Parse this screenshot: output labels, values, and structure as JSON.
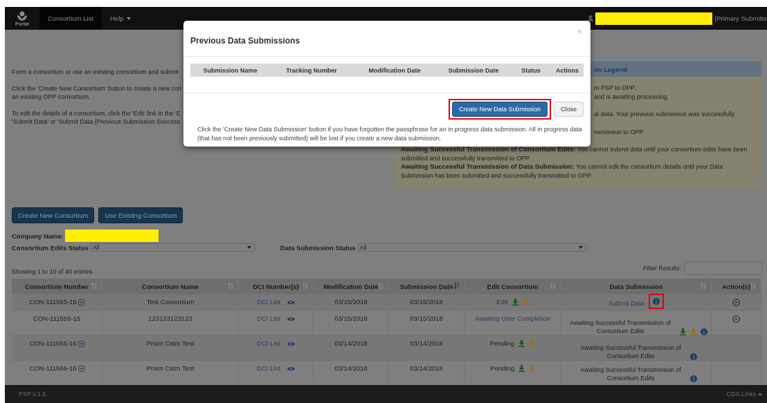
{
  "navbar": {
    "logo_text": "Portal",
    "items": [
      {
        "label": "Consortium List",
        "selected": true,
        "dropdown": false
      },
      {
        "label": "Help",
        "selected": false,
        "dropdown": true
      }
    ],
    "user_role": "(Primary Submitte"
  },
  "intro": {
    "paragraphs": [
      [
        "Form a consortium or use an existing consortium and submit"
      ],
      [
        "Click the 'Create New Consortium' button to create a new con",
        "an existing OPP consortium."
      ],
      [
        "To edit the details of a consortium, click the 'Edit' link in the 'E",
        "'Submit Data' or 'Submit Data (Previous Submission Success"
      ]
    ]
  },
  "legend": {
    "title": "on Legend",
    "paragraphs": [
      [
        "m PSP to OPP.",
        "and is awaiting processing."
      ],
      [
        "al data. Your previous submission was successfully"
      ],
      [
        "nsmission to OPP"
      ]
    ],
    "entries": [
      "**Awaiting Successful Transmission of Consortium Edits:** You cannot submit data until your consortium edits have been submitted and successfully transmitted to OPP.",
      "**Awaiting Successful Transmission of Data Submission:** You cannot edit the consortium details until your Data Submission has been submitted and successfully transmitted to OPP."
    ]
  },
  "buttons": [
    "Create New Consortium",
    "Use Existing Consortium"
  ],
  "company_name": {
    "label": "Company Name:"
  },
  "filters": [
    {
      "label": "Consortium Edits Status",
      "value": "All"
    },
    {
      "label": "Data Submission Status",
      "value": "All"
    }
  ],
  "entries_info": "Showing 1 to 10 of 40 entries",
  "filter_results": {
    "label": "Filter Results:"
  },
  "table": {
    "columns": [
      {
        "label": "Consortium Number",
        "sorted": false
      },
      {
        "label": "Consortium Name",
        "sorted": false
      },
      {
        "label": "DCI Number(s)",
        "sorted": false
      },
      {
        "label": "Modification Date",
        "sorted": false
      },
      {
        "label": "Submission Date",
        "sorted": true
      },
      {
        "label": "Edit Consortium",
        "sorted": false
      },
      {
        "label": "Data Submission",
        "sorted": false
      },
      {
        "label": "Action(s)",
        "sorted": false
      }
    ],
    "rows": [
      {
        "number": "CON-111555-15",
        "menu": true,
        "name": "Test Consortium",
        "dci": "DCI List",
        "modified": "03/15/2018",
        "submitted": "03/15/2018",
        "edit": {
          "text": "Edit",
          "kind": "link",
          "downloads": true
        },
        "data": {
          "text": "Submit Data",
          "kind": "link",
          "downloads": false,
          "highlighted": true
        },
        "action": true
      },
      {
        "number": "CON-111555-15",
        "menu": false,
        "name": "123123123123",
        "dci": "DCI List",
        "modified": "03/15/2018",
        "submitted": "03/15/2018",
        "edit": {
          "text": "Awaiting User Completion",
          "kind": "link",
          "downloads": false
        },
        "data": {
          "text": "Awaiting Successful Transmission of Consortium Edits",
          "kind": "plain",
          "downloads": true,
          "highlighted": false
        },
        "action": true
      },
      {
        "number": "CON-111666-16",
        "menu": true,
        "name": "Prism Cstm Test",
        "dci": "DCI List",
        "modified": "03/14/2018",
        "submitted": "03/14/2018",
        "edit": {
          "text": "Pending",
          "kind": "plain",
          "downloads": true
        },
        "data": {
          "text": "Awaiting Successful Transmission of Consortium Edits",
          "kind": "plain",
          "downloads": false,
          "highlighted": false
        },
        "action": false
      },
      {
        "number": "CON-111666-16",
        "menu": true,
        "name": "Prism Cstm Test",
        "dci": "DCI List",
        "modified": "03/14/2018",
        "submitted": "03/14/2018",
        "edit": {
          "text": "Pending",
          "kind": "plain",
          "downloads": true
        },
        "data": {
          "text": "Awaiting Successful Transmission of Consortium Edits",
          "kind": "plain",
          "downloads": false,
          "highlighted": false
        },
        "action": false
      }
    ]
  },
  "modal": {
    "title": "Previous Data Submissions",
    "close": "×",
    "columns": [
      "Submission Name",
      "Tracking Number",
      "Modification Date",
      "Submission Date",
      "Status",
      "Actions"
    ],
    "buttons": [
      {
        "label": "Create New Data Submission",
        "kind": "primary",
        "highlighted": true
      },
      {
        "label": "Close",
        "kind": "default",
        "highlighted": false
      }
    ],
    "note": "Click the 'Create New Data Submission' button if you have forgotten the passphrase for an in progress data submission. All in progress data (that has not been previously submitted) will be lost if you create a new data submission."
  },
  "footer": {
    "version": "PSP v.1.5",
    "links": "CDX Links"
  }
}
